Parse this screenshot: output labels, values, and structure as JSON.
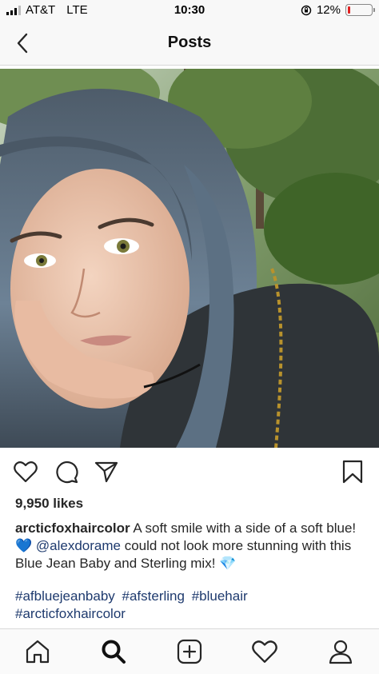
{
  "status_bar": {
    "carrier": "AT&T",
    "network": "LTE",
    "time": "10:30",
    "battery_percent": "12%",
    "battery_level": 0.12
  },
  "nav": {
    "title": "Posts"
  },
  "post": {
    "likes": "9,950 likes",
    "username": "arcticfoxhaircolor",
    "caption_part1": "A soft smile with a side of a soft blue! ",
    "heart_emoji": "💙",
    "mention": "@alexdorame",
    "caption_part2": " could not look more stunning with this Blue Jean Baby and Sterling mix! ",
    "gem_emoji": "💎",
    "hashtags": [
      "#afbluejeanbaby",
      "#afsterling",
      "#bluehair",
      "#arcticfoxhaircolor"
    ]
  },
  "colors": {
    "link": "#1e3a6e",
    "battery_low": "#e02020"
  }
}
